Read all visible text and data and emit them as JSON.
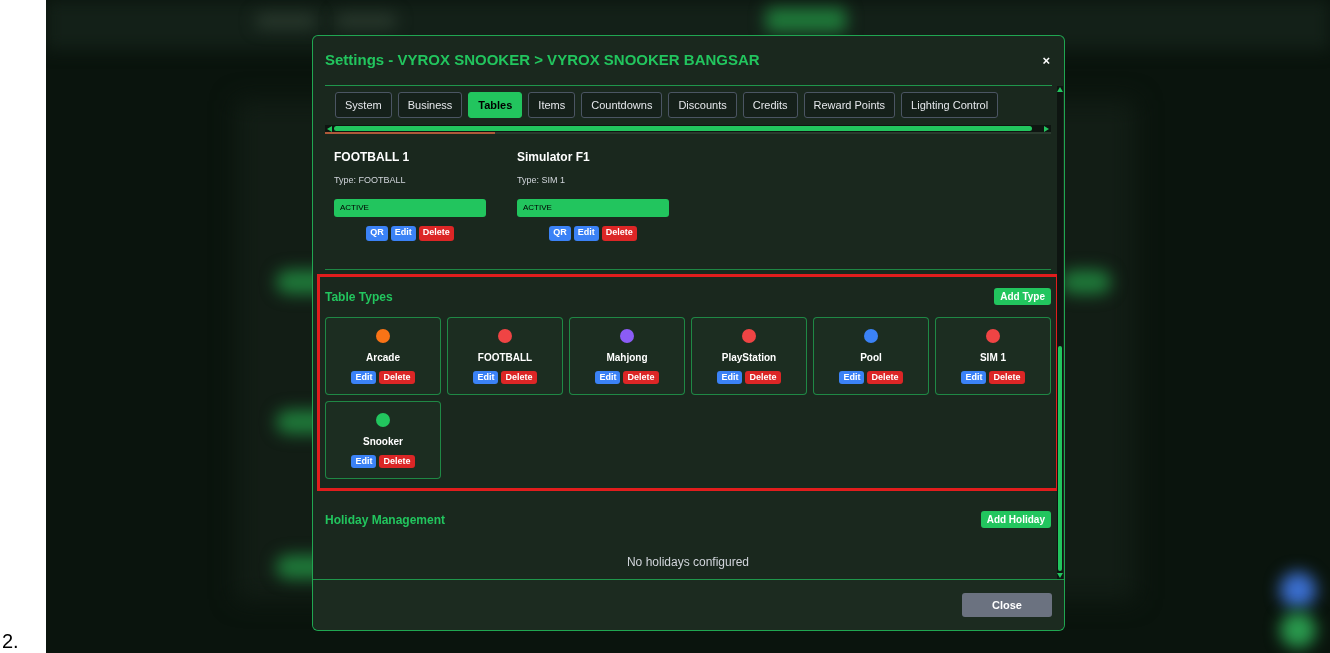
{
  "prefix_label": "2.",
  "dialog": {
    "title": "Settings - VYROX SNOOKER > VYROX SNOOKER BANGSAR",
    "close": "×",
    "tabs": [
      {
        "label": "System",
        "selected": false
      },
      {
        "label": "Business",
        "selected": false
      },
      {
        "label": "Tables",
        "selected": true
      },
      {
        "label": "Items",
        "selected": false
      },
      {
        "label": "Countdowns",
        "selected": false
      },
      {
        "label": "Discounts",
        "selected": false
      },
      {
        "label": "Credits",
        "selected": false
      },
      {
        "label": "Reward Points",
        "selected": false
      },
      {
        "label": "Lighting Control",
        "selected": false
      }
    ],
    "tables": [
      {
        "name": "FOOTBALL 1",
        "type": "Type: FOOTBALL",
        "status": "ACTIVE",
        "actions": [
          {
            "label": "QR",
            "kind": "primary"
          },
          {
            "label": "Edit",
            "kind": "primary"
          },
          {
            "label": "Delete",
            "kind": "danger"
          }
        ]
      },
      {
        "name": "Simulator F1",
        "type": "Type: SIM 1",
        "status": "ACTIVE",
        "actions": [
          {
            "label": "QR",
            "kind": "primary"
          },
          {
            "label": "Edit",
            "kind": "primary"
          },
          {
            "label": "Delete",
            "kind": "danger"
          }
        ]
      }
    ],
    "table_types": {
      "title": "Table Types",
      "add_button": "Add Type",
      "items": [
        {
          "name": "Arcade",
          "color": "#f97316",
          "actions": [
            {
              "label": "Edit",
              "kind": "primary"
            },
            {
              "label": "Delete",
              "kind": "danger"
            }
          ]
        },
        {
          "name": "FOOTBALL",
          "color": "#ef4444",
          "actions": [
            {
              "label": "Edit",
              "kind": "primary"
            },
            {
              "label": "Delete",
              "kind": "danger"
            }
          ]
        },
        {
          "name": "Mahjong",
          "color": "#8b5cf6",
          "actions": [
            {
              "label": "Edit",
              "kind": "primary"
            },
            {
              "label": "Delete",
              "kind": "danger"
            }
          ]
        },
        {
          "name": "PlayStation",
          "color": "#ef4444",
          "actions": [
            {
              "label": "Edit",
              "kind": "primary"
            },
            {
              "label": "Delete",
              "kind": "danger"
            }
          ]
        },
        {
          "name": "Pool",
          "color": "#3b82f6",
          "actions": [
            {
              "label": "Edit",
              "kind": "primary"
            },
            {
              "label": "Delete",
              "kind": "danger"
            }
          ]
        },
        {
          "name": "SIM 1",
          "color": "#ef4444",
          "actions": [
            {
              "label": "Edit",
              "kind": "primary"
            },
            {
              "label": "Delete",
              "kind": "danger"
            }
          ]
        },
        {
          "name": "Snooker",
          "color": "#22c55e",
          "actions": [
            {
              "label": "Edit",
              "kind": "primary"
            },
            {
              "label": "Delete",
              "kind": "danger"
            }
          ]
        }
      ]
    },
    "holidays": {
      "title": "Holiday Management",
      "add_button": "Add Holiday",
      "empty_text": "No holidays configured"
    },
    "footer_button": "Close"
  }
}
